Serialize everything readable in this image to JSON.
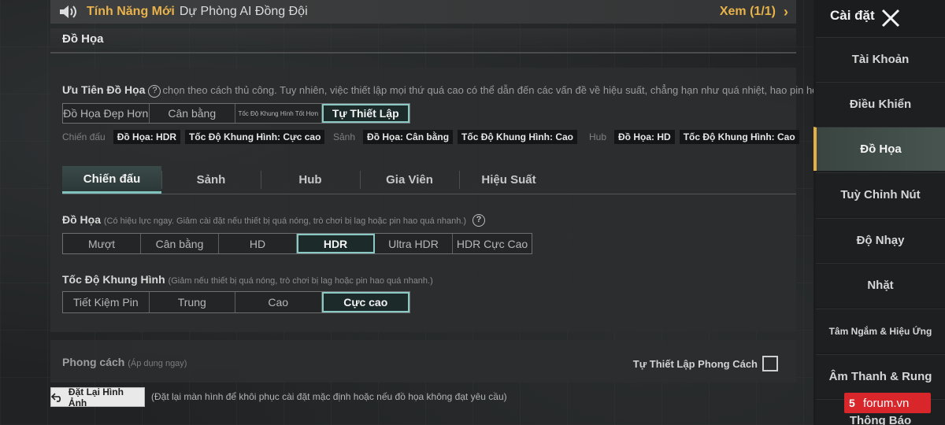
{
  "announcement": {
    "highlight": "Tính Năng Mới",
    "message": "Dự Phòng AI Đồng Đội",
    "view": "Xem (1/1)"
  },
  "section_title": "Đồ Họa",
  "priority": {
    "label": "Ưu Tiên Đồ Họa",
    "desc": "chọn theo cách thủ công. Tuy nhiên, việc thiết lập mọi thứ quá cao có thể dẫn đến các vấn đề về hiệu suất, chẳng hạn như quá nhiệt, hao pin hoặc chơi game bị lag.)",
    "options": [
      "Đồ Họa Đẹp Hơn",
      "Cân bằng",
      "Tốc Độ Khung Hình Tốt Hơn",
      "Tự Thiết Lập"
    ],
    "selected": "Tự Thiết Lập"
  },
  "mode_info": [
    {
      "mode": "Chiến đấu",
      "graphics": "Đồ Họa: HDR",
      "fps": "Tốc Độ Khung Hình: Cực cao"
    },
    {
      "mode": "Sảnh",
      "graphics": "Đồ Họa: Cân bằng",
      "fps": "Tốc Độ Khung Hình: Cao"
    },
    {
      "mode": "Hub",
      "graphics": "Đồ Họa: HD",
      "fps": "Tốc Độ Khung Hình: Cao"
    }
  ],
  "tabs": [
    "Chiến đấu",
    "Sảnh",
    "Hub",
    "Gia Viên",
    "Hiệu Suất"
  ],
  "active_tab": "Chiến đấu",
  "graphics": {
    "label": "Đồ Họa",
    "hint": "(Có hiệu lực ngay. Giảm cài đặt nếu thiết bị quá nóng, trò chơi bị lag hoặc pin hao quá nhanh.)",
    "options": [
      "Mượt",
      "Cân bằng",
      "HD",
      "HDR",
      "Ultra HDR",
      "HDR Cực Cao"
    ],
    "selected": "HDR"
  },
  "frame_rate": {
    "label": "Tốc Độ Khung Hình",
    "hint": "(Giảm nếu thiết bị quá nóng, trò chơi bị lag hoặc pin hao quá nhanh.)",
    "options": [
      "Tiết Kiệm Pin",
      "Trung",
      "Cao",
      "Cực cao"
    ],
    "selected": "Cực cao"
  },
  "style": {
    "label": "Phong cách",
    "hint": "(Áp dụng ngay)",
    "custom_label": "Tự Thiết Lập Phong Cách",
    "custom_checked": false
  },
  "reset": {
    "button": "Đặt Lại Hình Ảnh",
    "note": "(Đặt lại màn hình để khôi phục cài đặt mặc định hoặc nếu đồ họa không đạt yêu cầu)"
  },
  "sidebar": {
    "title": "Cài đặt",
    "items": [
      "Tài Khoản",
      "Điều Khiển",
      "Đồ Họa",
      "Tuỳ Chỉnh Nút",
      "Độ Nhạy",
      "Nhặt",
      "Tâm Ngắm & Hiệu Ứng",
      "Âm Thanh & Rung",
      "Thông Báo"
    ],
    "active": "Đồ Họa"
  },
  "watermark": "forum.vn",
  "colors": {
    "accent_gold": "#e9b24a",
    "accent_teal": "#8bc9c4",
    "watermark_red": "#d9262a"
  }
}
